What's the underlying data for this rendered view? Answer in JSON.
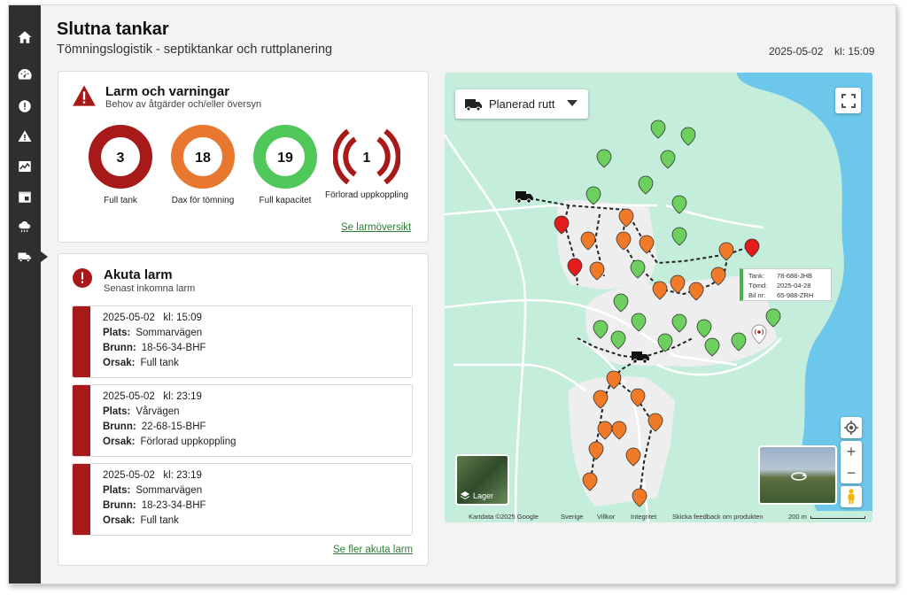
{
  "header": {
    "title": "Slutna tankar",
    "subtitle": "Tömningslogistik - septiktankar och ruttplanering",
    "date": "2025-05-02",
    "time": "kl: 15:09"
  },
  "sidebar": {
    "items": [
      {
        "icon": "home-icon"
      },
      {
        "icon": "dashboard-icon"
      },
      {
        "icon": "alert-circle-icon"
      },
      {
        "icon": "warning-icon"
      },
      {
        "icon": "chart-icon"
      },
      {
        "icon": "calendar-icon"
      },
      {
        "icon": "weather-icon"
      },
      {
        "icon": "truck-icon",
        "active": true
      }
    ]
  },
  "alarms": {
    "title": "Larm och varningar",
    "subtitle": "Behov av åtgärder och/eller översyn",
    "gauges": [
      {
        "value": "3",
        "label": "Full tank",
        "color": "#a81919"
      },
      {
        "value": "18",
        "label": "Dax för tömning",
        "color": "#e87830"
      },
      {
        "value": "19",
        "label": "Full kapacitet",
        "color": "#4fc759"
      },
      {
        "value": "1",
        "label": "Förlorad uppkoppling",
        "color": "#a81919"
      }
    ],
    "link": "Se larmöversikt"
  },
  "acute": {
    "title": "Akuta larm",
    "subtitle": "Senast inkomna larm",
    "labels": {
      "place": "Plats:",
      "well": "Brunn:",
      "reason": "Orsak:"
    },
    "items": [
      {
        "date": "2025-05-02",
        "time": "kl: 15:09",
        "place": "Sommarvägen",
        "well": "18-56-34-BHF",
        "reason": "Full tank"
      },
      {
        "date": "2025-05-02",
        "time": "kl: 23:19",
        "place": "Vårvägen",
        "well": "22-68-15-BHF",
        "reason": "Förlorad uppkoppling"
      },
      {
        "date": "2025-05-02",
        "time": "kl: 23:19",
        "place": "Sommarvägen",
        "well": "18-23-34-BHF",
        "reason": "Full tank"
      }
    ],
    "link": "Se fler akuta larm"
  },
  "map": {
    "route_select": "Planerad rutt",
    "layers_label": "Lager",
    "tooltip": {
      "tank_label": "Tank:",
      "tank": "78-688-JHB",
      "emptied_label": "Tömd:",
      "emptied": "2025-04-28",
      "car_label": "Bil nr:",
      "car": "65-988-ZRH"
    },
    "attribution": [
      "Kartdata ©2025 Google",
      "Sverige",
      "Villkor",
      "Integritet",
      "Skicka feedback om produkten",
      "200 m"
    ],
    "colors": {
      "full": "#e21b1b",
      "due": "#f07a28",
      "ok": "#6ccf5e",
      "water": "#6cc7ea",
      "land": "#c4eddc",
      "settlement": "#eeeeee"
    }
  }
}
